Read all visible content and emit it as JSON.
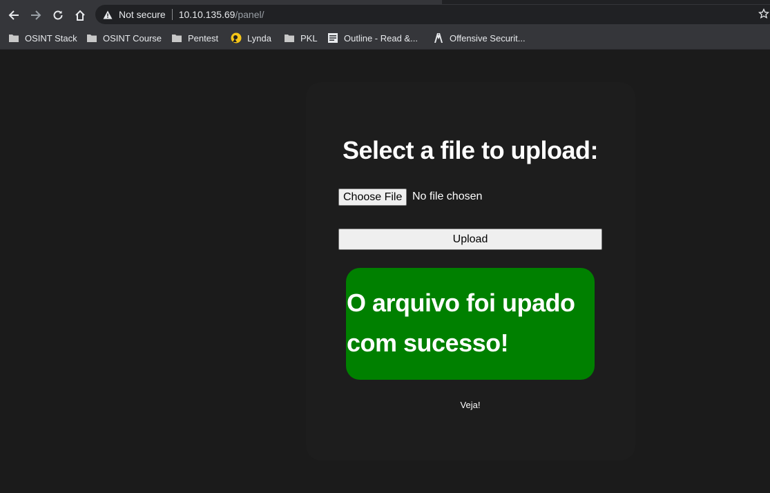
{
  "browser": {
    "address_bar": {
      "security_label": "Not secure",
      "host": "10.10.135.69",
      "path": "/panel/"
    },
    "bookmarks": [
      {
        "label": "OSINT Stack",
        "icon": "folder-icon"
      },
      {
        "label": "OSINT Course",
        "icon": "folder-icon"
      },
      {
        "label": "Pentest",
        "icon": "folder-icon"
      },
      {
        "label": "Lynda",
        "icon": "lynda-icon"
      },
      {
        "label": "PKL",
        "icon": "folder-icon"
      },
      {
        "label": "Outline - Read &...",
        "icon": "document-icon"
      },
      {
        "label": "Offensive Securit...",
        "icon": "offsec-icon"
      }
    ]
  },
  "upload_form": {
    "heading": "Select a file to upload:",
    "choose_file_label": "Choose File",
    "no_file_text": "No file chosen",
    "upload_label": "Upload"
  },
  "success_message": {
    "line1": "O arquivo foi upado",
    "line2": "com sucesso!",
    "color": "#008000"
  },
  "link": {
    "label": "Veja!"
  }
}
